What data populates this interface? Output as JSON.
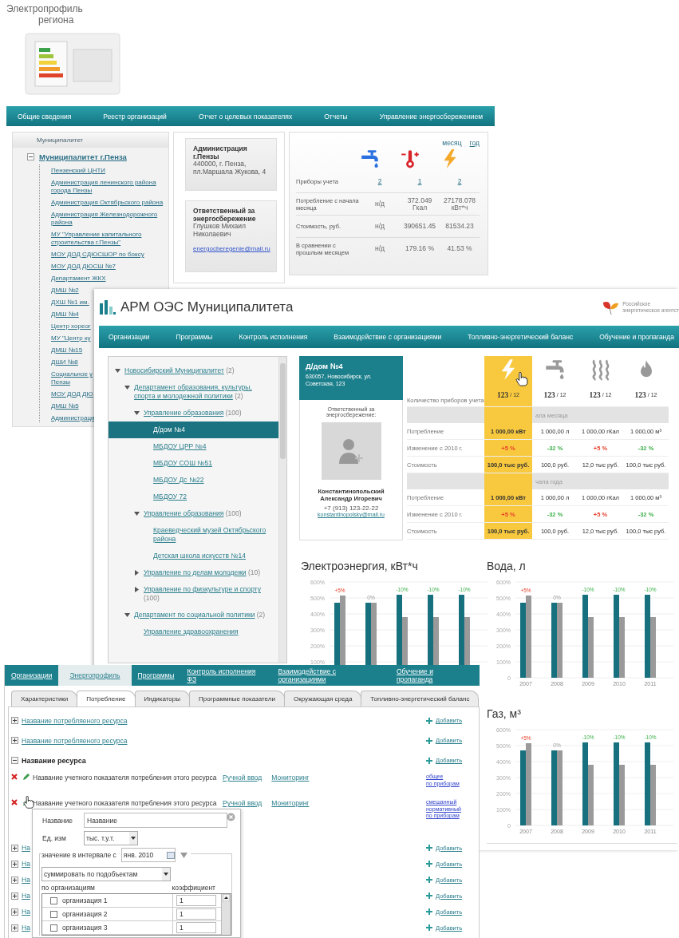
{
  "regional_portal": {
    "logo": {
      "line_1": "Электропрофиль",
      "line_2": "региона"
    },
    "nav": [
      "Общие сведения",
      "Реестр организаций",
      "Отчет о целевых показателях",
      "Отчеты",
      "Управление энергосбережением"
    ],
    "sidebar": {
      "title": "Муниципалитет",
      "root": {
        "label": "Муниципалитет г.Пенза",
        "expanded": true,
        "children": [
          {
            "label": "Пензенский ЦНТИ"
          },
          {
            "label": "Администрация ленинского района города Пензы"
          },
          {
            "label": "Администрация Октябрьского района"
          },
          {
            "label": "Администрация Железнодорожного района"
          },
          {
            "label": "МУ \"Управление капитального строительства г.Пензы\""
          },
          {
            "label": "МОУ ДОД СДЮСШОР по боксу"
          },
          {
            "label": "МОУ ДОД ДЮСШ №7"
          },
          {
            "label": "Департамент ЖКХ"
          },
          {
            "label": "ДМШ №2"
          },
          {
            "label": "ДХШ №1 им."
          },
          {
            "label": "ДМШ №4"
          },
          {
            "label": "Центр хореог"
          },
          {
            "label": "МУ \"Центр ку"
          },
          {
            "label": "ДМШ №15"
          },
          {
            "label": "ДШИ №8"
          },
          {
            "label": "Социальное у\nПензы"
          },
          {
            "label": "МОУ ДОД ДЮ"
          },
          {
            "label": "ДМШ №5"
          },
          {
            "label": "Администраци"
          }
        ]
      }
    },
    "admin_card": {
      "name": "Администрация г.Пензы",
      "address": "440000, г. Пенза, пл.Маршала Жукова, 4"
    },
    "responsible_card": {
      "heading": "Ответственный за энергосбережение",
      "person": "Глушков Михаил Николаевич",
      "email": "energocberegenie@mail.ru"
    },
    "period_switch": [
      {
        "label": "месяц",
        "selected": true
      },
      {
        "label": "год",
        "selected": false
      }
    ],
    "resources": [
      {
        "kind": "water"
      },
      {
        "kind": "heat"
      },
      {
        "kind": "electricity"
      }
    ],
    "rows": [
      {
        "kind": "link",
        "label": "Приборы учета",
        "values": [
          "2",
          "1",
          "2"
        ]
      },
      {
        "kind": "text",
        "label": "Потребление с начала месяца",
        "values": [
          "н/д",
          "372.049 Гкал",
          "27178.078 кВт*ч"
        ]
      },
      {
        "kind": "text",
        "label": "Стоимость, руб.",
        "values": [
          "н/д",
          "390651.45",
          "81534.23"
        ]
      },
      {
        "kind": "text",
        "label": "В сравнении с прошлым месяцем",
        "values": [
          "н/д",
          "179.16 %",
          "41.53 %"
        ]
      }
    ]
  },
  "municipal_workstation": {
    "title": "АРМ ОЭС Муниципалитета",
    "agency": [
      "Российское",
      "энергетическое агентст"
    ],
    "nav": [
      "Организации",
      "Программы",
      "Контроль исполнения",
      "Взаимодействие с организациями",
      "Топливно-энергетический баланс",
      "Обучение и пропаганда"
    ],
    "tree": [
      {
        "label": "Новосибирский Муниципалитет",
        "count": "(2)",
        "expanded": true,
        "selected": false,
        "children": [
          {
            "label": "Департамент образования, культуры, спорта и молодежной политики",
            "count": "(2)",
            "expanded": true,
            "selected": false,
            "children": [
              {
                "label": "Управление образования",
                "count": "(100)",
                "expanded": true,
                "selected": false,
                "children": [
                  {
                    "label": "Д/дом №4",
                    "selected": true
                  },
                  {
                    "label": "МБДОУ ЦРР №4",
                    "selected": false
                  },
                  {
                    "label": "МБДОУ СОШ №51",
                    "selected": false
                  },
                  {
                    "label": "МБДОУ Дс №22",
                    "selected": false
                  },
                  {
                    "label": "МБДОУ 72",
                    "selected": false
                  }
                ]
              },
              {
                "label": "Управление образования",
                "count": "(100)",
                "expanded": true,
                "selected": false,
                "children": [
                  {
                    "label": "Краеведческий музей Октябрьского района",
                    "selected": false
                  },
                  {
                    "label": "Детская школа искусств №14",
                    "selected": false
                  }
                ]
              },
              {
                "label": "Управление по делам молодежи",
                "count": "(10)",
                "expanded": false,
                "selected": false
              },
              {
                "label": "Управление по физкультуре и спорту",
                "count": "(100)",
                "expanded": false,
                "selected": false
              }
            ]
          },
          {
            "label": "Департамент по социальной политики",
            "count": "(2)",
            "expanded": true,
            "selected": false,
            "children": [
              {
                "label": "Управление здравоохранения",
                "selected": false
              }
            ]
          }
        ]
      }
    ],
    "object_card": {
      "name": "Д/дом №4",
      "address": "630057, Новосибирск, ул. Советская, 123",
      "responsible_label": "Ответственный за энергосбережение:",
      "person": "Константинопольский Александр Игоревич",
      "phone": "+7 (913) 123-22-22",
      "email": "konstantinopolsky@mail.ru"
    },
    "meters": {
      "count_label": "Количество приборов учета",
      "columns": [
        {
          "kind": "electricity",
          "selected": true,
          "count": "123",
          "total": "/ 12"
        },
        {
          "kind": "water",
          "selected": false,
          "count": "123",
          "total": "/ 12"
        },
        {
          "kind": "heat",
          "selected": false,
          "count": "123",
          "total": "/ 12"
        },
        {
          "kind": "gas",
          "selected": false,
          "count": "123",
          "total": "/ 12"
        }
      ],
      "sections": [
        {
          "title": "ала месяца",
          "rows": [
            {
              "label": "Потребление",
              "values": [
                {
                  "text": "1 000,00 кВт"
                },
                {
                  "text": "1 000,00 л"
                },
                {
                  "text": "1 000,00 гКал"
                },
                {
                  "text": "1 000,00 м³"
                }
              ]
            },
            {
              "label": "Изменение с 2010 г.",
              "values": [
                {
                  "text": "+5 %",
                  "color": "#e8412c"
                },
                {
                  "text": "-32 %",
                  "color": "#3cb04a"
                },
                {
                  "text": "+5 %",
                  "color": "#e8412c"
                },
                {
                  "text": "-32 %",
                  "color": "#3cb04a"
                }
              ]
            },
            {
              "label": "Стоимость",
              "values": [
                {
                  "text": "100,0 тыс руб."
                },
                {
                  "text": "100,0 руб."
                },
                {
                  "text": "12,0 тыс руб."
                },
                {
                  "text": "100,0 тыс руб."
                }
              ]
            }
          ]
        },
        {
          "title": "чала года",
          "rows": [
            {
              "label": "Потребление",
              "values": [
                {
                  "text": "1 000,00 кВт"
                },
                {
                  "text": "1 000,00 л"
                },
                {
                  "text": "1 000,00 гКал"
                },
                {
                  "text": "1 000,00 м³"
                }
              ]
            },
            {
              "label": "Изменение с 2010 г.",
              "values": [
                {
                  "text": "+5 %",
                  "color": "#e8412c"
                },
                {
                  "text": "-32 %",
                  "color": "#3cb04a"
                },
                {
                  "text": "+5 %",
                  "color": "#e8412c"
                },
                {
                  "text": "-32 %",
                  "color": "#3cb04a"
                }
              ]
            },
            {
              "label": "Стоимость",
              "values": [
                {
                  "text": "100,0 тыс руб."
                },
                {
                  "text": "100,0 руб."
                },
                {
                  "text": "12,0 тыс руб."
                },
                {
                  "text": "100,0 тыс руб."
                }
              ]
            }
          ]
        }
      ]
    },
    "charts": [
      {
        "chart_data": {
          "type": "bar",
          "title": "Электроэнергия, кВт*ч",
          "stacked": false,
          "ylim": [
            0,
            600
          ],
          "grid": true,
          "yticks": [
            {
              "value": 100,
              "label": "100%"
            },
            {
              "value": 200,
              "label": "200%"
            },
            {
              "value": 300,
              "label": "300%"
            },
            {
              "value": 400,
              "label": "400%"
            },
            {
              "value": 500,
              "label": "500%"
            },
            {
              "value": 600,
              "label": "600%"
            }
          ],
          "series": [
            {
              "color": "#17707e",
              "values": [
                470,
                470,
                520,
                520,
                520
              ]
            },
            {
              "color": "#9a9a9a",
              "values": [
                515,
                470,
                380,
                380,
                380
              ]
            }
          ],
          "value_labels": [
            "+5%",
            "0%",
            "-10%",
            "-10%",
            "-10%"
          ]
        }
      },
      {
        "chart_data": {
          "type": "bar",
          "title": "Вода, л",
          "stacked": false,
          "categories": [
            "2007",
            "2008",
            "2009",
            "2010",
            "2011"
          ],
          "ylim": [
            0,
            600
          ],
          "grid": true,
          "yticks": [
            {
              "value": 0,
              "label": "0"
            },
            {
              "value": 100,
              "label": "100%"
            },
            {
              "value": 200,
              "label": "200%"
            },
            {
              "value": 300,
              "label": "300%"
            },
            {
              "value": 400,
              "label": "400%"
            },
            {
              "value": 500,
              "label": "500%"
            },
            {
              "value": 600,
              "label": "600%"
            }
          ],
          "series": [
            {
              "color": "#17707e",
              "values": [
                470,
                470,
                520,
                520,
                520
              ]
            },
            {
              "color": "#9a9a9a",
              "values": [
                515,
                470,
                380,
                380,
                380
              ]
            }
          ],
          "value_labels": [
            "+5%",
            "0%",
            "-10%",
            "-10%",
            "-10%"
          ]
        }
      },
      {
        "chart_data": {
          "type": "bar",
          "title": "Газ, м³",
          "stacked": false,
          "categories": [
            "2007",
            "2008",
            "2009",
            "2010",
            "2011"
          ],
          "ylim": [
            0,
            600
          ],
          "grid": true,
          "yticks": [
            {
              "value": 0,
              "label": "0"
            },
            {
              "value": 100,
              "label": "100%"
            },
            {
              "value": 200,
              "label": "200%"
            },
            {
              "value": 300,
              "label": "300%"
            },
            {
              "value": 400,
              "label": "400%"
            },
            {
              "value": 500,
              "label": "500%"
            },
            {
              "value": 600,
              "label": "600%"
            }
          ],
          "series": [
            {
              "color": "#17707e",
              "values": [
                470,
                470,
                520,
                520,
                520
              ]
            },
            {
              "color": "#9a9a9a",
              "values": [
                515,
                470,
                380,
                380,
                380
              ]
            }
          ],
          "value_labels": [
            "+5%",
            "0%",
            "-10%",
            "-10%",
            "-10%"
          ]
        }
      }
    ]
  },
  "energy_profile_editor": {
    "nav": [
      {
        "label": "Организации",
        "selected": false
      },
      {
        "label": "Энергопрофиль",
        "selected": true
      },
      {
        "label": "Программы",
        "selected": false
      },
      {
        "label": "Контроль исполнения ФЗ",
        "selected": false
      },
      {
        "label": "Взаимодействие с организациями",
        "selected": false
      },
      {
        "label": "Обучение и пропаганда",
        "selected": false
      }
    ],
    "tabs": [
      {
        "label": "Характеристики",
        "selected": false
      },
      {
        "label": "Потребление",
        "selected": true
      },
      {
        "label": "Индикаторы",
        "selected": false
      },
      {
        "label": "Программные показатели",
        "selected": false
      },
      {
        "label": "Окружающая среда",
        "selected": false
      },
      {
        "label": "Топливно-энергетический баланс",
        "selected": false
      }
    ],
    "rows": [
      {
        "kind": "resource",
        "label": "Название потребляеного ресурса",
        "expanded": false,
        "add_label": "Добавить"
      },
      {
        "kind": "resource",
        "label": "Название потребляеного ресурса",
        "expanded": false,
        "add_label": "Добавить"
      },
      {
        "kind": "resource",
        "label": "Название ресурса",
        "expanded": true,
        "add_label": "Добавить"
      },
      {
        "kind": "indicator",
        "label": "Название учетного показателя потребления этого ресурса",
        "manual_link": "Ручной ввод",
        "monitoring_link": "Мониторинг",
        "mode_lines": [
          "общее",
          "по приборам"
        ]
      },
      {
        "kind": "indicator",
        "label": "Название учетного показателя потребления этого ресурса",
        "manual_link": "Ручной ввод",
        "monitoring_link": "Мониторинг",
        "mode_lines": [
          "смешанный",
          "нормативный",
          "по приборам"
        ]
      },
      {
        "kind": "resource",
        "label": "На",
        "expanded": false,
        "add_label": "Добавить"
      },
      {
        "kind": "resource",
        "label": "На",
        "expanded": false,
        "add_label": "Добавить"
      },
      {
        "kind": "resource",
        "label": "На",
        "expanded": false,
        "add_label": "Добавить"
      },
      {
        "kind": "resource",
        "label": "На",
        "expanded": false,
        "add_label": "Добавить"
      },
      {
        "kind": "resource",
        "label": "На",
        "expanded": false,
        "add_label": "Добавить"
      },
      {
        "kind": "resource",
        "label": "На",
        "expanded": false,
        "add_label": "Добавить"
      }
    ],
    "popup": {
      "name_label": "Название",
      "name_value": "Название",
      "unit_label": "Ед. изм",
      "unit_value": "тыс. т.у.т.",
      "interval_label": "значение в интервале с",
      "interval_value": "янв. 2010",
      "aggregation": "суммировать по подобъектам",
      "org_header": "по организациям",
      "coef_header": "коэффициент",
      "orgs": [
        {
          "name": "организация 1",
          "checked": false,
          "coefficient": "1"
        },
        {
          "name": "организация 2",
          "checked": false,
          "coefficient": "1"
        },
        {
          "name": "организация 3",
          "checked": false,
          "coefficient": "1"
        }
      ]
    }
  }
}
